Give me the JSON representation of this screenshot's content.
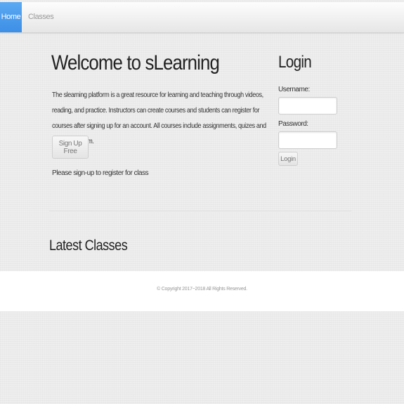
{
  "nav": {
    "home_label": "Home",
    "classes_label": "Classes",
    "accent_color": "#4a9bed"
  },
  "welcome": {
    "title": "Welcome to sLearning",
    "intro": "The slearning platform is a great resource for learning and teaching through videos, reading, and practice. Instructors can create courses and students can register for courses after signing up for an account. All courses include assignments, quizes and a support forum.",
    "signup_label": "Sign Up Free",
    "signup_note": "Please sign-up to register for class"
  },
  "login": {
    "title": "Login",
    "username_label": "Username:",
    "username_value": "",
    "password_label": "Password:",
    "password_value": "",
    "submit_label": "Login"
  },
  "latest": {
    "title": "Latest Classes"
  },
  "footer": {
    "copyright": "© Copyright 2017~2018 All Rights Reserved."
  }
}
